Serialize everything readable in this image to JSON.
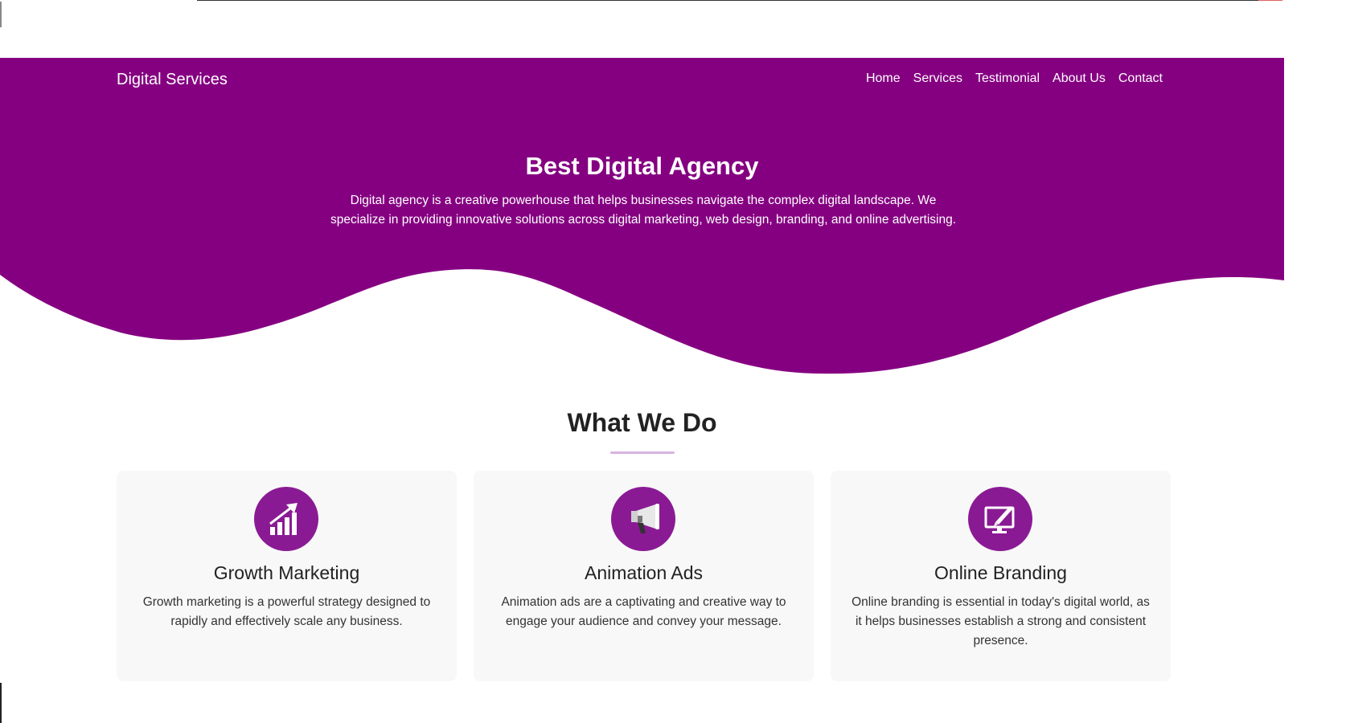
{
  "colors": {
    "primary": "#850081",
    "icon_bg": "#8a1a94",
    "card_bg": "#f8f8f8",
    "underline": "#d9b3e0"
  },
  "header": {
    "brand": "Digital Services",
    "nav": [
      "Home",
      "Services",
      "Testimonial",
      "About Us",
      "Contact"
    ]
  },
  "hero": {
    "title": "Best Digital Agency",
    "text": "Digital agency is a creative powerhouse that helps businesses navigate the complex digital landscape. We specialize in providing innovative solutions across digital marketing, web design, branding, and online advertising."
  },
  "services": {
    "title": "What We Do",
    "items": [
      {
        "icon": "growth-chart-icon",
        "title": "Growth Marketing",
        "text": "Growth marketing is a powerful strategy designed to rapidly and effectively scale any business."
      },
      {
        "icon": "megaphone-icon",
        "title": "Animation Ads",
        "text": "Animation ads are a captivating and creative way to engage your audience and convey your message."
      },
      {
        "icon": "monitor-pen-icon",
        "title": "Online Branding",
        "text": "Online branding is essential in today's digital world, as it helps businesses establish a strong and consistent presence."
      }
    ]
  }
}
